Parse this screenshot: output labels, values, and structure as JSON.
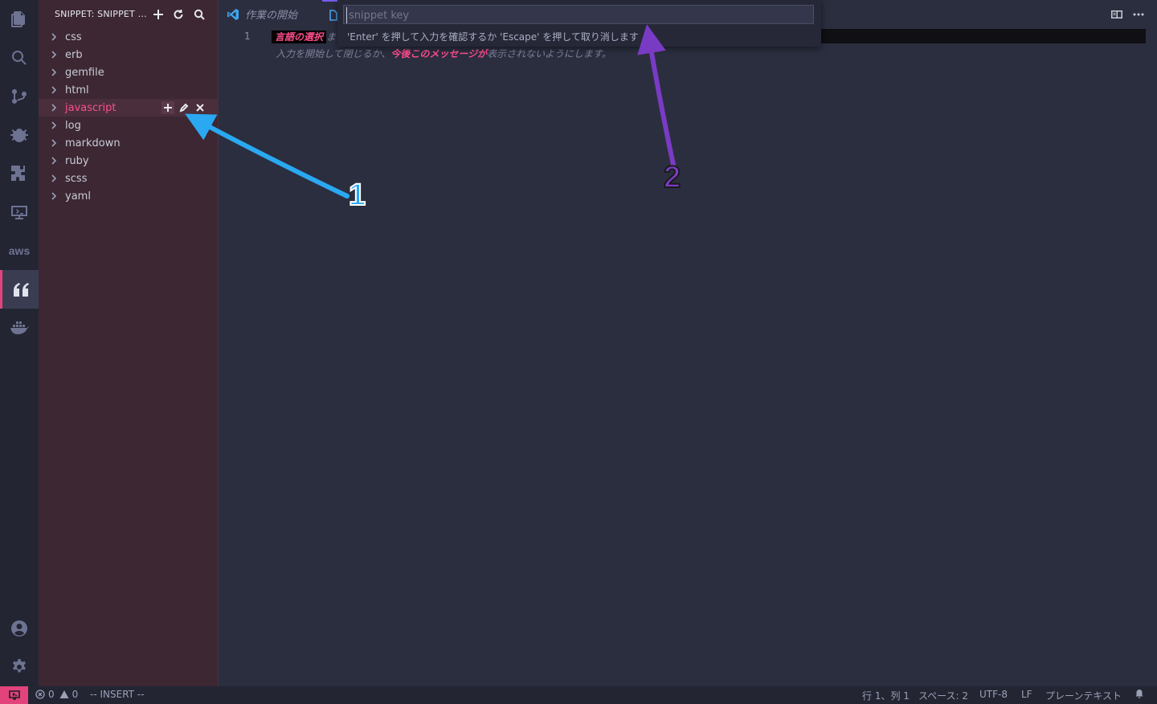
{
  "activity_bar": {
    "items": [
      "explorer",
      "search",
      "source-control",
      "debug",
      "extensions",
      "remote-explorer",
      "aws",
      "snippets",
      "docker"
    ],
    "aws_label": "aws",
    "active": "snippets",
    "accent_color": "#e2437b"
  },
  "sidebar": {
    "title": "SNIPPET: SNIPPET ...",
    "actions": [
      "add-icon",
      "refresh-icon",
      "search-icon"
    ],
    "items": [
      {
        "label": "css"
      },
      {
        "label": "erb"
      },
      {
        "label": "gemfile"
      },
      {
        "label": "html"
      },
      {
        "label": "javascript",
        "selected": true
      },
      {
        "label": "log"
      },
      {
        "label": "markdown"
      },
      {
        "label": "ruby"
      },
      {
        "label": "scss"
      },
      {
        "label": "yaml"
      }
    ],
    "row_actions": [
      "add-icon",
      "edit-icon",
      "close-icon"
    ],
    "selected_color": "#ff4d8d"
  },
  "tabs": [
    {
      "label": "作業の開始",
      "icon": "vscode-icon"
    },
    {
      "label": "",
      "icon": "file-icon",
      "active": true
    }
  ],
  "editor": {
    "line_number": "1",
    "hint_select": "言語の選択",
    "hint_rest": "ま",
    "hint_line2_a": "入力を開始して閉じるか、",
    "hint_line2_link": "今後このメッセージが",
    "hint_line2_b": "表示されないようにします。"
  },
  "quick_input": {
    "placeholder": "snippet key",
    "value": "",
    "message": "'Enter' を押して入力を確認するか 'Escape' を押して取り消します"
  },
  "annotations": [
    {
      "label": "1",
      "color": "#2aa8f2"
    },
    {
      "label": "2",
      "color": "#7a3bc4"
    }
  ],
  "status_bar": {
    "errors": "0",
    "warnings": "0",
    "mode": "-- INSERT --",
    "position": "行 1、列 1",
    "indent": "スペース: 2",
    "encoding": "UTF-8",
    "eol": "LF",
    "language": "プレーンテキスト",
    "remote_color": "#e2437b"
  }
}
